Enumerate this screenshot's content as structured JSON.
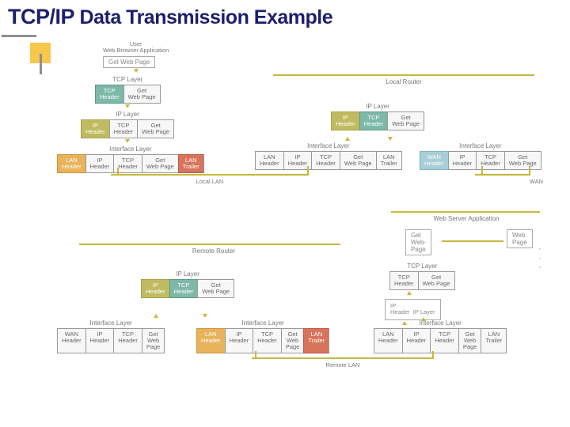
{
  "title_main": "TCP/IP",
  "title_sub": "Data Transmission Example",
  "nodes": {
    "user": "User\nWeb Browser Application",
    "get_web_page": "Get Web Page",
    "tcp_layer": "TCP Layer",
    "ip_layer": "IP Layer",
    "interface_layer": "Interface Layer",
    "local_router": "Local Router",
    "local_lan": "Local LAN",
    "wan": "WAN",
    "remote_router": "Remote Router",
    "remote_lan": "Remote LAN",
    "web_server_app": "Web Server Application",
    "web_page": "Web\nPage"
  },
  "hdr": {
    "tcp": "TCP\nHeader",
    "ip": "IP\nHeader",
    "lan": "LAN\nHeader",
    "wan": "WAN\nHeader",
    "lan_trailer": "LAN\nTrailer",
    "get_web": "Get\nWeb Page",
    "get_web2": "Get\nWeb\nPage",
    "get_web3": "Get\nWeb-\nPage"
  }
}
